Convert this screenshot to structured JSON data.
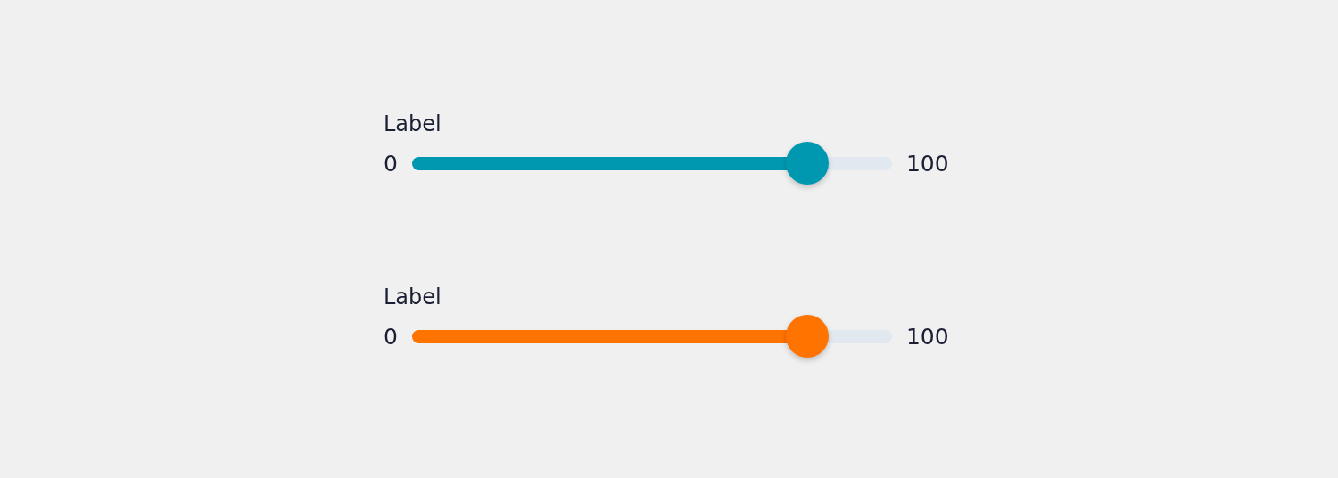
{
  "sliders": [
    {
      "label": "Label",
      "min": "0",
      "max": "100",
      "level": 0.823,
      "color": "#0098b0"
    },
    {
      "label": "Label",
      "min": "0",
      "max": "100",
      "level": 0.823,
      "color": "#ff7300"
    }
  ]
}
